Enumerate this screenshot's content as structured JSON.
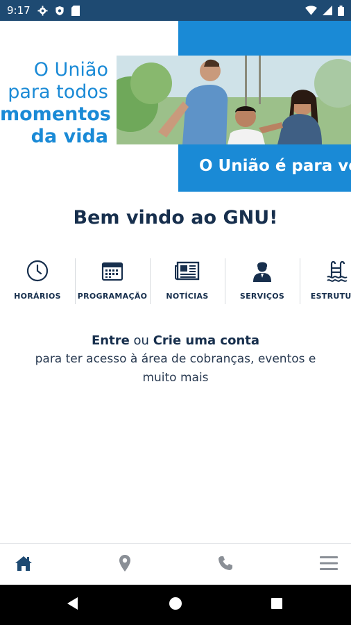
{
  "status_bar": {
    "time": "9:17",
    "icons": [
      "gear-icon",
      "shield-icon",
      "sd-card-icon",
      "wifi-icon",
      "signal-icon",
      "battery-icon"
    ]
  },
  "banner": {
    "headline": [
      "O União",
      "para todos",
      "momentos",
      "da vida"
    ],
    "tagline": "O União é para você"
  },
  "welcome_title": "Bem vindo ao GNU!",
  "shortcuts": [
    {
      "label": "HORÁRIOS",
      "icon": "clock-icon"
    },
    {
      "label": "PROGRAMAÇÃO",
      "icon": "calendar-icon"
    },
    {
      "label": "NOTÍCIAS",
      "icon": "newspaper-icon"
    },
    {
      "label": "SERVIÇOS",
      "icon": "person-icon"
    },
    {
      "label": "ESTRUTURA",
      "icon": "pool-ladder-icon"
    }
  ],
  "account": {
    "login": "Entre",
    "or": "ou",
    "signup": "Crie uma conta",
    "description": "para ter acesso à área de cobranças, eventos e muito mais"
  },
  "bottom_nav": [
    {
      "name": "home",
      "icon": "home-icon",
      "active": true
    },
    {
      "name": "location",
      "icon": "map-pin-icon",
      "active": false
    },
    {
      "name": "phone",
      "icon": "phone-icon",
      "active": false
    },
    {
      "name": "menu",
      "icon": "menu-icon",
      "active": false
    }
  ],
  "colors": {
    "status_bar": "#1e4a72",
    "brand_blue": "#1a8ad6",
    "navy_text": "#172f4d",
    "active_nav": "#1e4a72",
    "inactive_nav": "#8a8f96"
  }
}
